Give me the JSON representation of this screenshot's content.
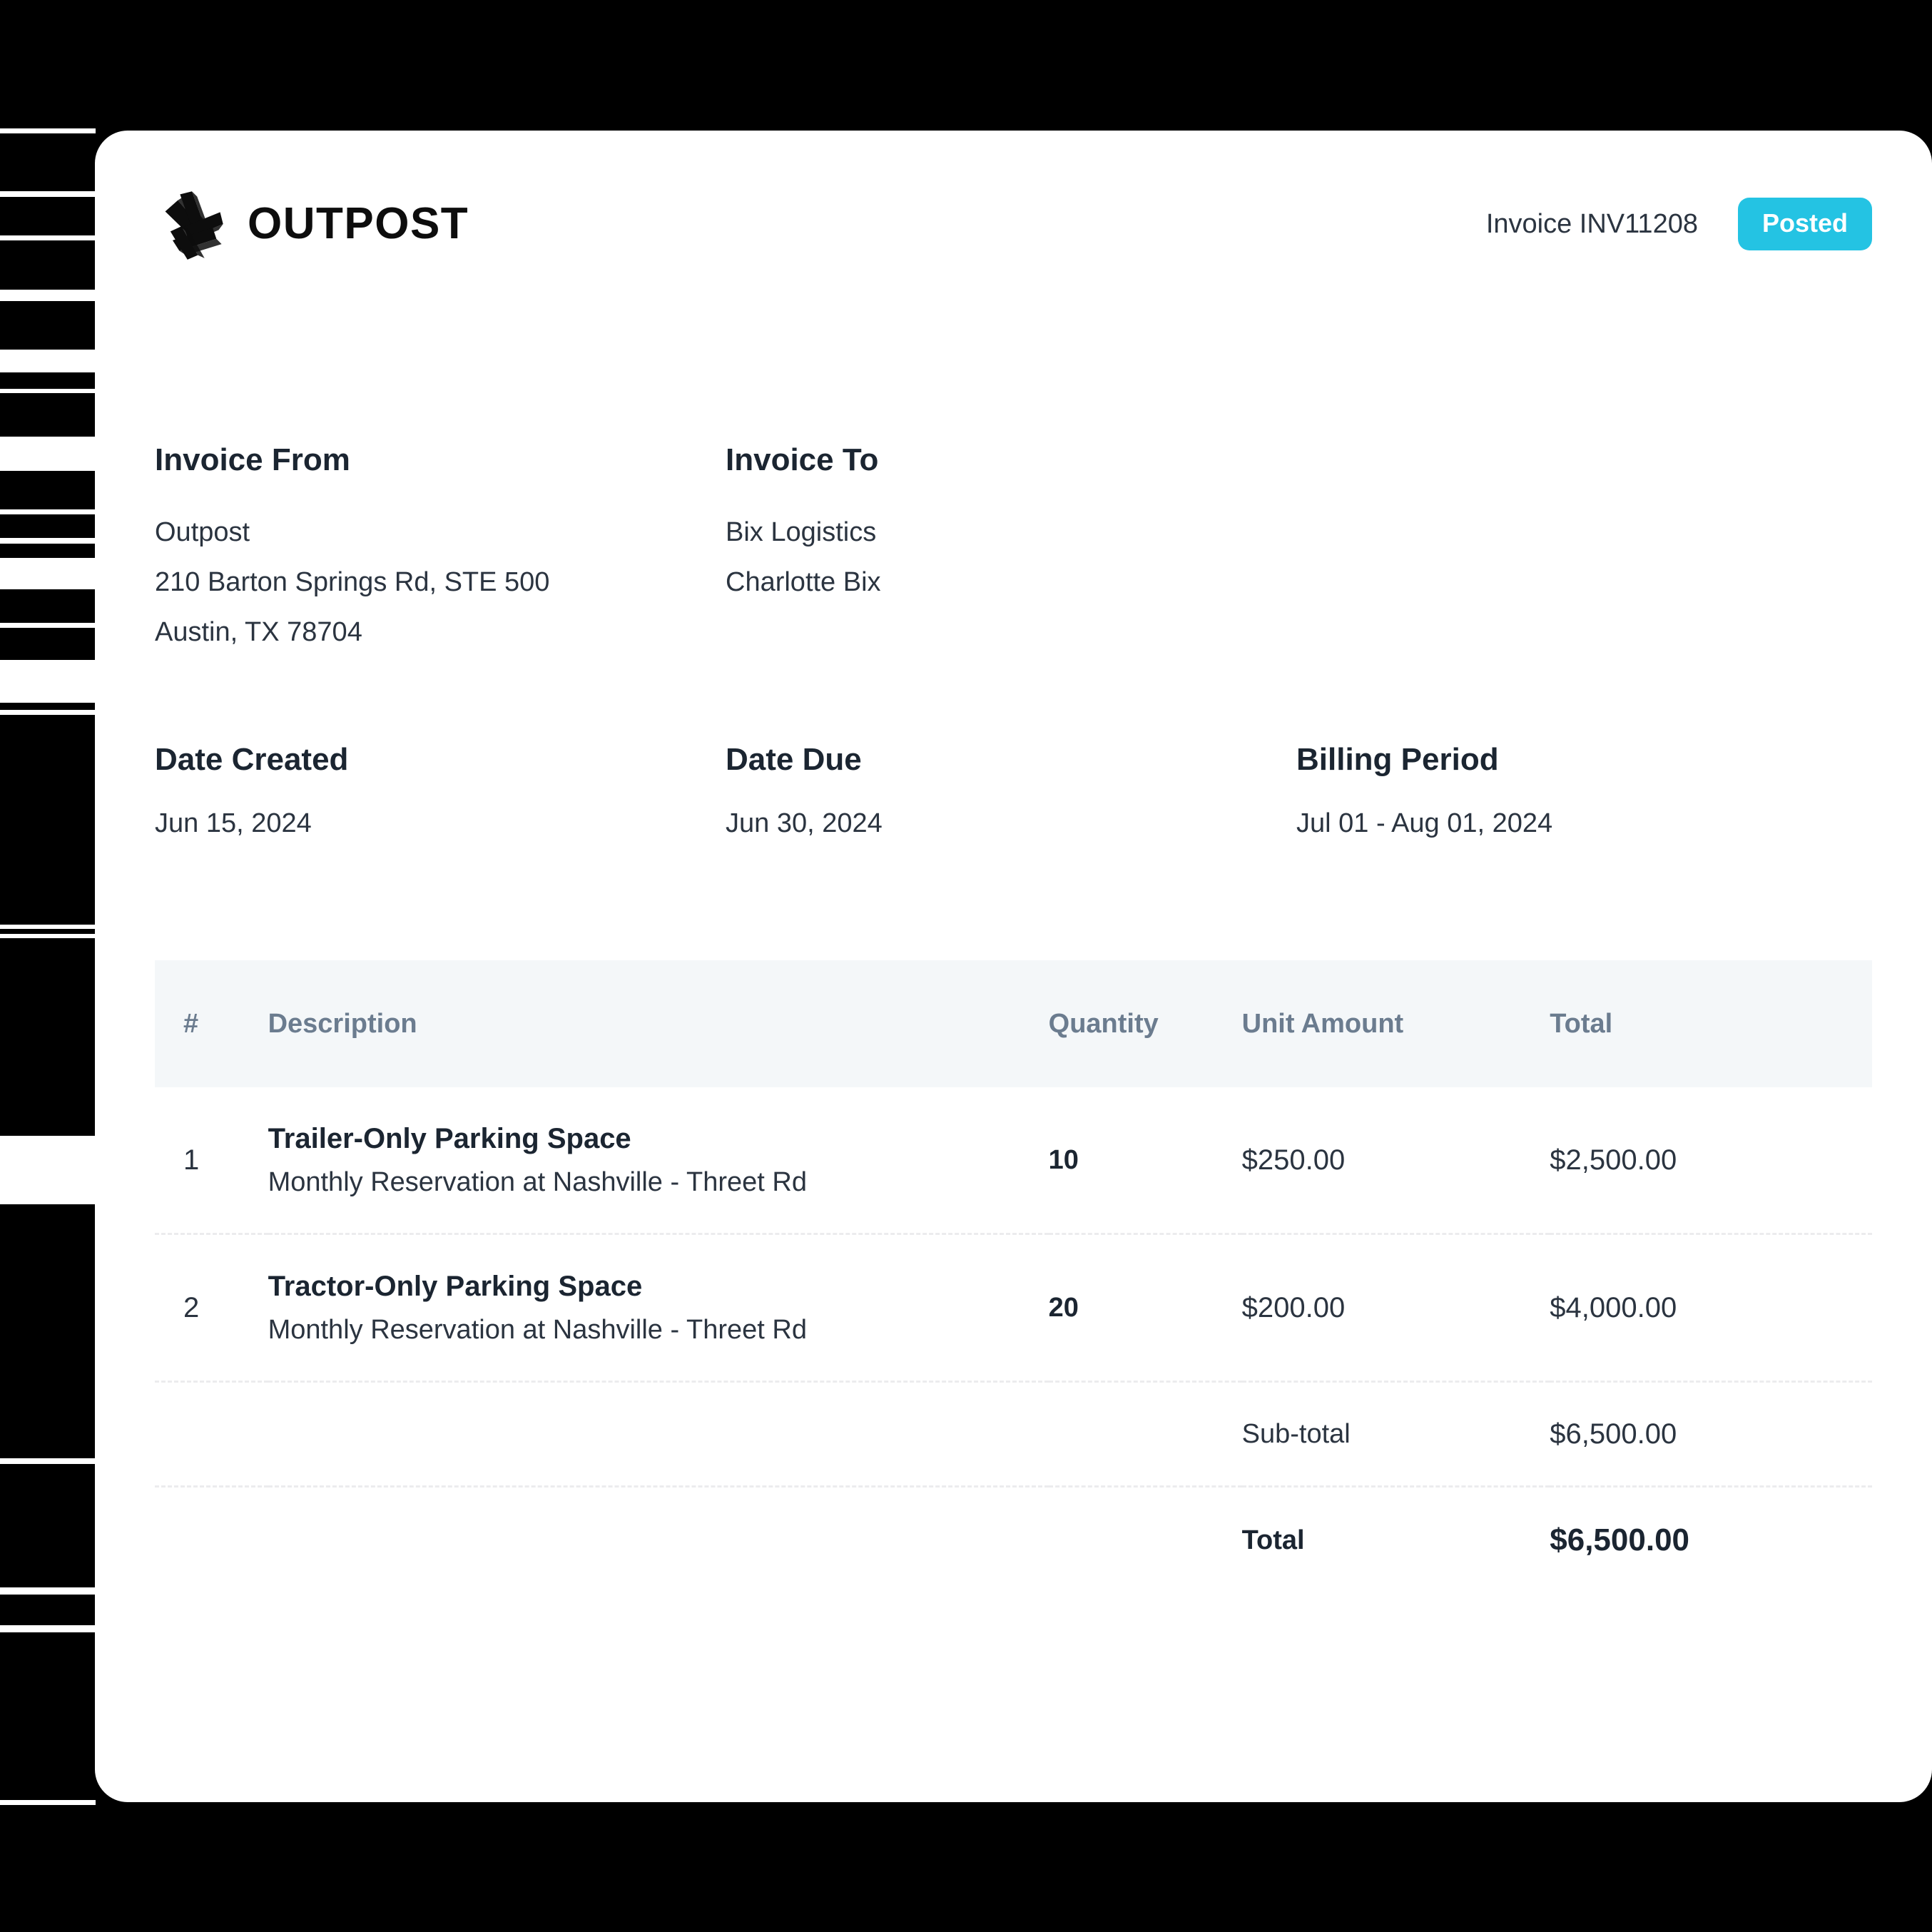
{
  "background": {
    "color": "#000000",
    "stripe_color": "#ffffff"
  },
  "card": {
    "background": "#ffffff"
  },
  "header": {
    "brand_name": "OUTPOST",
    "logo_icon": "outpost-interlocking-beams-logo",
    "invoice_number_label": "Invoice INV11208",
    "status_badge": "Posted",
    "status_color": "#24c3e3"
  },
  "parties": {
    "from": {
      "label": "Invoice From",
      "lines": [
        "Outpost",
        "210 Barton Springs Rd, STE 500",
        "Austin, TX 78704"
      ]
    },
    "to": {
      "label": "Invoice To",
      "lines": [
        "Bix Logistics",
        "Charlotte Bix"
      ]
    }
  },
  "dates": {
    "created": {
      "label": "Date Created",
      "value": "Jun 15, 2024"
    },
    "due": {
      "label": "Date Due",
      "value": "Jun 30, 2024"
    },
    "billing_period": {
      "label": "Billing Period",
      "value": "Jul 01 - Aug 01, 2024"
    }
  },
  "table": {
    "columns": {
      "num": "#",
      "description": "Description",
      "quantity": "Quantity",
      "unit_amount": "Unit Amount",
      "total": "Total"
    },
    "rows": [
      {
        "num": "1",
        "title": "Trailer-Only Parking Space",
        "subtitle": "Monthly Reservation at Nashville - Threet Rd",
        "quantity": "10",
        "unit_amount": "$250.00",
        "total": "$2,500.00"
      },
      {
        "num": "2",
        "title": "Tractor-Only Parking Space",
        "subtitle": "Monthly Reservation at Nashville - Threet Rd",
        "quantity": "20",
        "unit_amount": "$200.00",
        "total": "$4,000.00"
      }
    ],
    "summary": [
      {
        "label": "Sub-total",
        "value": "$6,500.00"
      },
      {
        "label": "Total",
        "value": "$6,500.00"
      }
    ]
  }
}
